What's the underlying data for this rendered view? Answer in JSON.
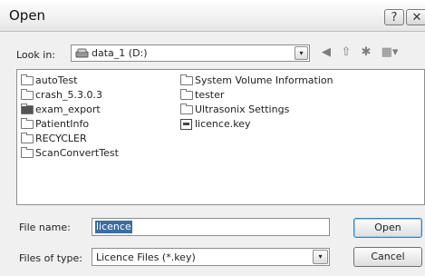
{
  "window": {
    "title": "Open",
    "help_label": "?",
    "close_label": "✕"
  },
  "lookin": {
    "label": "Look in:",
    "value": "data_1 (D:)",
    "dropdown_glyph": "▾",
    "toolbar": [
      {
        "name": "back-icon",
        "glyph": "◀"
      },
      {
        "name": "up-folder-icon",
        "glyph": "⇧"
      },
      {
        "name": "new-folder-icon",
        "glyph": "✱"
      },
      {
        "name": "views-menu-icon",
        "glyph": "▦▾"
      }
    ]
  },
  "files": [
    {
      "label": "autoTest",
      "icon": "folder-icon"
    },
    {
      "label": "crash_5.3.0.3",
      "icon": "folder-icon"
    },
    {
      "label": "exam_export",
      "icon": "shared-folder-icon"
    },
    {
      "label": "PatientInfo",
      "icon": "folder-icon"
    },
    {
      "label": "RECYCLER",
      "icon": "folder-icon"
    },
    {
      "label": "ScanConvertTest",
      "icon": "folder-icon"
    },
    {
      "label": "System Volume Information",
      "icon": "folder-icon"
    },
    {
      "label": "tester",
      "icon": "folder-icon"
    },
    {
      "label": "Ultrasonix Settings",
      "icon": "folder-icon"
    },
    {
      "label": "licence.key",
      "icon": "key-file-icon"
    }
  ],
  "filename": {
    "label": "File name:",
    "value": "licence"
  },
  "filetype": {
    "label": "Files of type:",
    "value": "Licence Files (*.key)",
    "dropdown_glyph": "▾"
  },
  "buttons": {
    "open_label": "Open",
    "cancel_label": "Cancel"
  }
}
